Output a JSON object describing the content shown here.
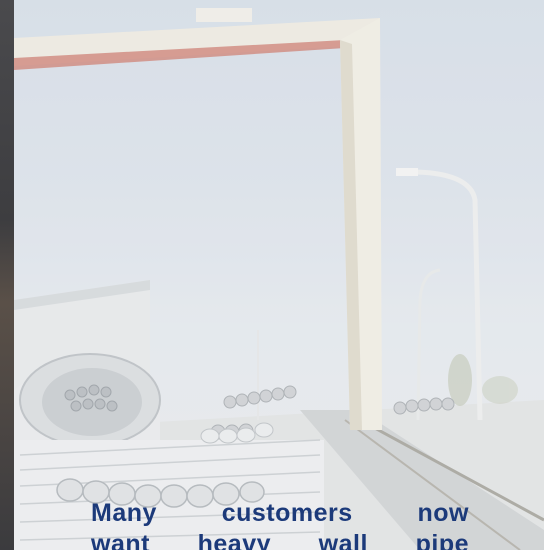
{
  "caption": {
    "line1": "Many customers now",
    "line2": "want heavy wall pipe"
  },
  "colors": {
    "caption_text": "#1c3a7a",
    "sky": "#cfd8e2",
    "crane_beam_stripe": "#c8766a"
  },
  "scene_description_icons": [
    "gantry-crane-icon",
    "street-lamp-icon",
    "pipe-stack-icon"
  ]
}
